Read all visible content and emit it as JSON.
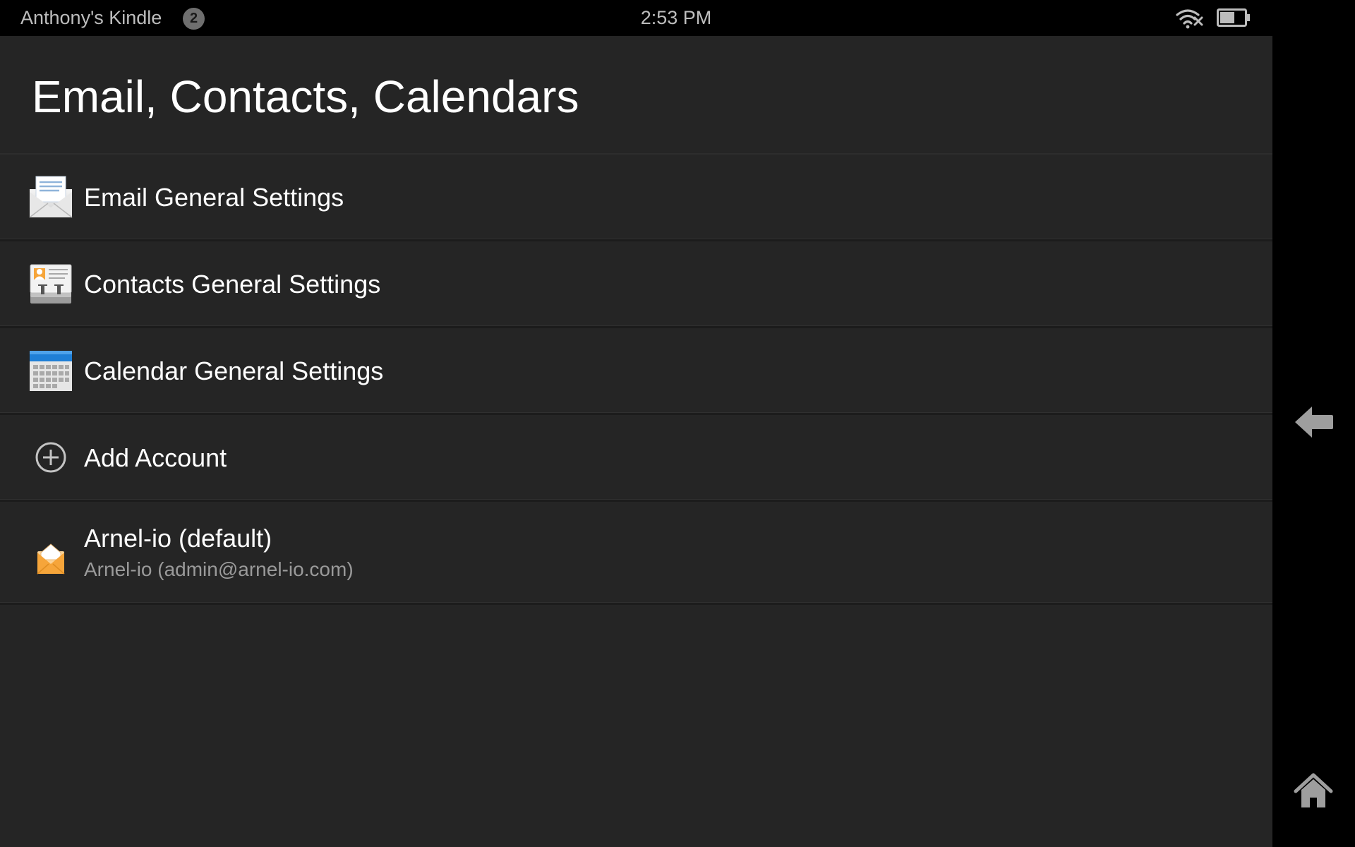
{
  "status_bar": {
    "device_name": "Anthony's Kindle",
    "notification_count": "2",
    "time": "2:53 PM",
    "wifi_icon": "wifi-disconnected-icon",
    "battery_icon": "battery-icon"
  },
  "page": {
    "title": "Email, Contacts, Calendars"
  },
  "settings_list": {
    "items": [
      {
        "label": "Email General Settings",
        "icon": "envelope-icon"
      },
      {
        "label": "Contacts General Settings",
        "icon": "contacts-card-icon"
      },
      {
        "label": "Calendar General Settings",
        "icon": "calendar-icon"
      },
      {
        "label": "Add Account",
        "icon": "add-circle-icon"
      },
      {
        "label": "Arnel-io (default)",
        "sublabel": "Arnel-io (admin@arnel-io.com)",
        "icon": "account-mail-icon"
      }
    ]
  },
  "side_nav": {
    "back_icon": "back-arrow-icon",
    "home_icon": "home-icon"
  },
  "colors": {
    "background": "#252525",
    "status_bar": "#000000",
    "text_primary": "#ffffff",
    "text_secondary": "#9a9a9a",
    "account_accent": "#f6a53a",
    "calendar_accent": "#1f7fd6"
  }
}
